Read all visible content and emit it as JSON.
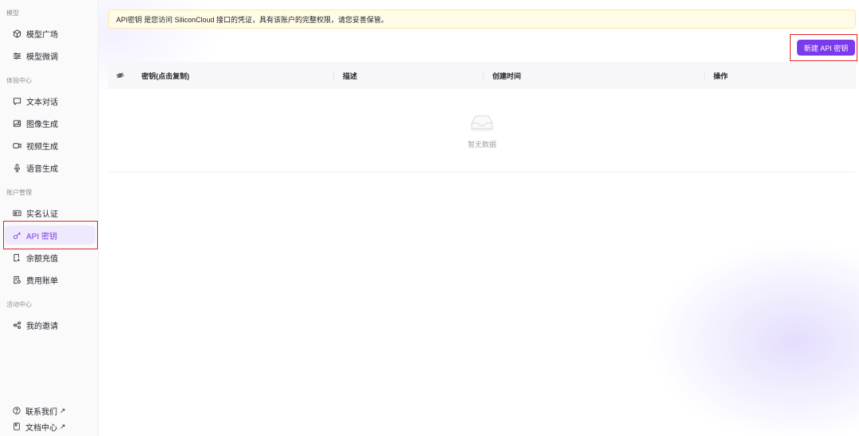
{
  "sidebar": {
    "sections": [
      {
        "title": "模型",
        "items": [
          {
            "label": "模型广场",
            "icon": "cube-icon"
          },
          {
            "label": "模型微调",
            "icon": "sliders-icon"
          }
        ]
      },
      {
        "title": "体验中心",
        "items": [
          {
            "label": "文本对话",
            "icon": "chat-icon"
          },
          {
            "label": "图像生成",
            "icon": "image-icon"
          },
          {
            "label": "视频生成",
            "icon": "video-icon"
          },
          {
            "label": "语音生成",
            "icon": "microphone-icon"
          }
        ]
      },
      {
        "title": "账户管理",
        "items": [
          {
            "label": "实名认证",
            "icon": "id-card-icon"
          },
          {
            "label": "API 密钥",
            "icon": "key-icon",
            "active": true
          },
          {
            "label": "余额充值",
            "icon": "wallet-icon"
          },
          {
            "label": "费用账单",
            "icon": "bill-icon"
          }
        ]
      },
      {
        "title": "活动中心",
        "items": [
          {
            "label": "我的邀请",
            "icon": "share-icon"
          }
        ]
      }
    ],
    "footer": [
      {
        "label": "联系我们",
        "icon": "help-circle-icon",
        "arrow": "↗"
      },
      {
        "label": "文档中心",
        "icon": "document-icon",
        "arrow": "↗"
      }
    ]
  },
  "notice": {
    "text": "API密钥 是您访问 SiliconCloud 接口的凭证，具有该账户的完整权限，请您妥善保管。"
  },
  "toolbar": {
    "create_label": "新建 API 密钥"
  },
  "table": {
    "columns": [
      "密钥(点击复制)",
      "描述",
      "创建时间",
      "操作"
    ],
    "rows": [],
    "empty_text": "暂无数据"
  },
  "colors": {
    "accent": "#7c3aed",
    "highlight": "#e0242a",
    "notice_bg": "#fffbe6"
  }
}
